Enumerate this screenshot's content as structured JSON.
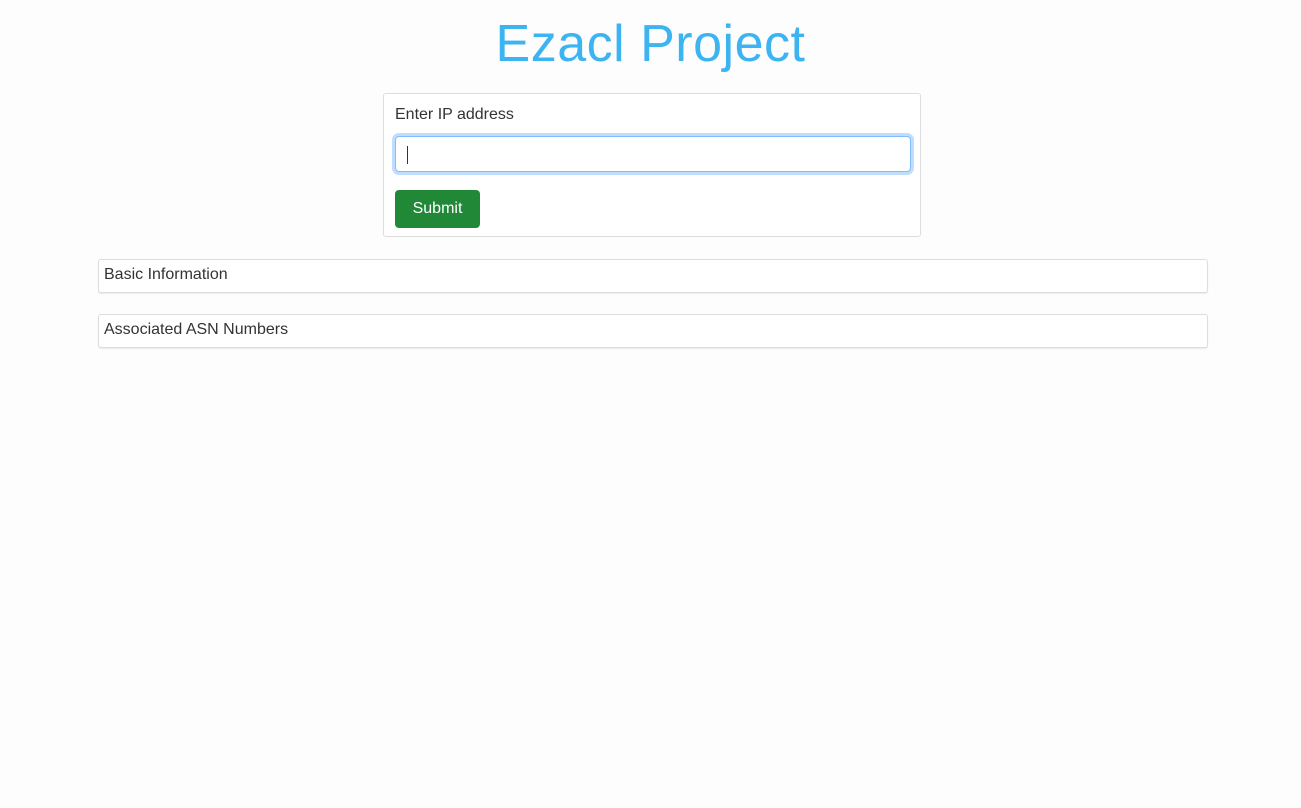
{
  "header": {
    "title": "Ezacl Project"
  },
  "form": {
    "label": "Enter IP address",
    "input_value": "",
    "submit_label": "Submit"
  },
  "panels": [
    {
      "title": "Basic Information"
    },
    {
      "title": "Associated ASN Numbers"
    }
  ]
}
